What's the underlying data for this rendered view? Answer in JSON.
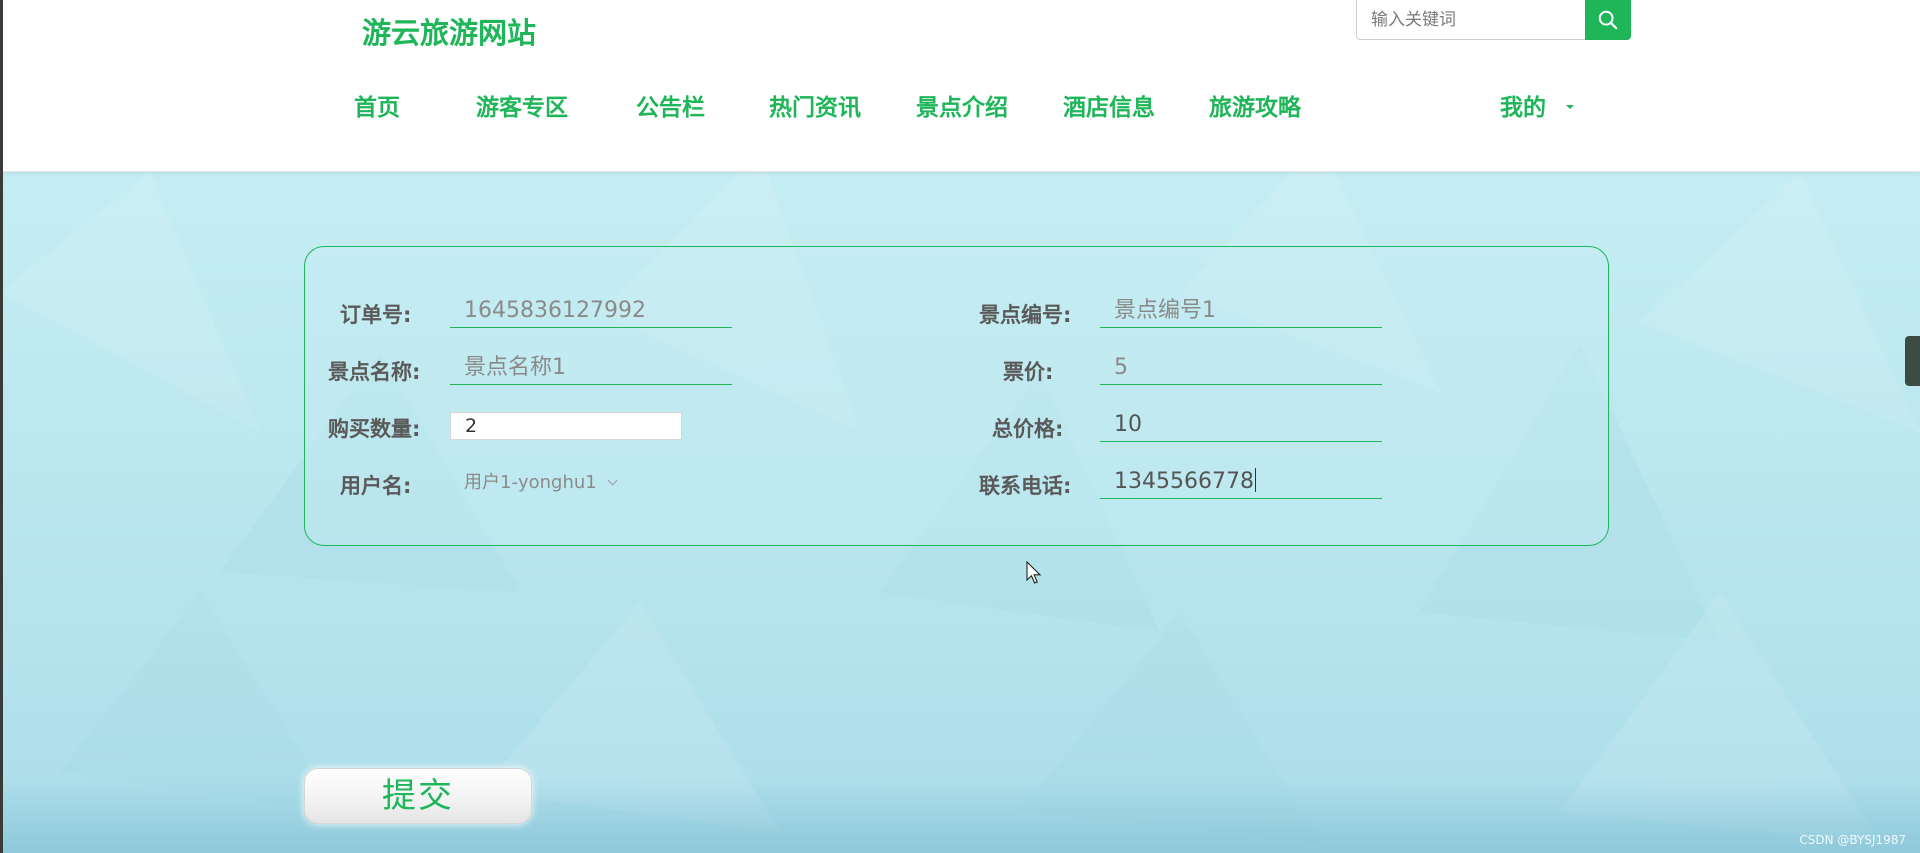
{
  "header": {
    "site_title": "游云旅游网站",
    "search_placeholder": "输入关键词",
    "nav": [
      {
        "label": "首页"
      },
      {
        "label": "游客专区"
      },
      {
        "label": "公告栏"
      },
      {
        "label": "热门资讯"
      },
      {
        "label": "景点介绍"
      },
      {
        "label": "酒店信息"
      },
      {
        "label": "旅游攻略"
      }
    ],
    "mine_label": "我的"
  },
  "form": {
    "order_no": {
      "label": "订单号:",
      "value": "1645836127992"
    },
    "spot_no": {
      "label": "景点编号:",
      "value": "景点编号1"
    },
    "spot_name": {
      "label": "景点名称:",
      "value": "景点名称1"
    },
    "ticket_price": {
      "label": "票价:",
      "value": "5"
    },
    "quantity": {
      "label": "购买数量:",
      "value": "2"
    },
    "total_price": {
      "label": "总价格:",
      "value": "10"
    },
    "username": {
      "label": "用户名:",
      "value": "用户1-yonghu1"
    },
    "phone": {
      "label": "联系电话:",
      "value": "1345566778"
    }
  },
  "submit_label": "提交",
  "watermark": "CSDN @BYSJ1987",
  "colors": {
    "accent": "#1fb559"
  }
}
